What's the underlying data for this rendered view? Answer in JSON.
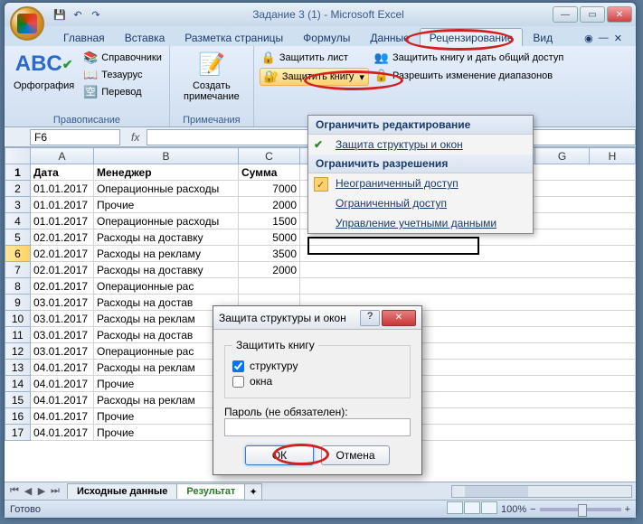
{
  "title": "Задание 3 (1) - Microsoft Excel",
  "qat": {
    "save": "💾",
    "undo": "↶",
    "redo": "↷"
  },
  "tabs": {
    "home": "Главная",
    "insert": "Вставка",
    "page_layout": "Разметка страницы",
    "formulas": "Формулы",
    "data": "Данные",
    "review": "Рецензирование",
    "view": "Вид"
  },
  "ribbon": {
    "spelling_group": "Правописание",
    "spelling": "Орфография",
    "references": "Справочники",
    "thesaurus": "Тезаурус",
    "translate": "Перевод",
    "comments_group": "Примечания",
    "new_comment": "Создать примечание",
    "protect_sheet": "Защитить лист",
    "protect_book": "Защитить книгу",
    "share_book": "Защитить книгу и дать общий доступ",
    "allow_ranges": "Разрешить изменение диапазонов"
  },
  "dropdown": {
    "hdr1": "Ограничить редактирование",
    "item1": "Защита структуры и окон",
    "hdr2": "Ограничить разрешения",
    "item2": "Неограниченный доступ",
    "item3": "Ограниченный доступ",
    "item4": "Управление учетными данными"
  },
  "namebox": "F6",
  "fx": "fx",
  "headers": {
    "rc": "",
    "A": "A",
    "B": "B",
    "C": "C",
    "G": "G",
    "H": "H"
  },
  "colnames": {
    "A": "Дата",
    "B": "Менеджер",
    "C": "Сумма"
  },
  "rows": [
    {
      "n": 2,
      "a": "01.01.2017",
      "b": "Операционные расходы",
      "c": "7000"
    },
    {
      "n": 3,
      "a": "01.01.2017",
      "b": "Прочие",
      "c": "2000"
    },
    {
      "n": 4,
      "a": "01.01.2017",
      "b": "Операционные расходы",
      "c": "1500"
    },
    {
      "n": 5,
      "a": "02.01.2017",
      "b": "Расходы на доставку",
      "c": "5000"
    },
    {
      "n": 6,
      "a": "02.01.2017",
      "b": "Расходы на рекламу",
      "c": "3500"
    },
    {
      "n": 7,
      "a": "02.01.2017",
      "b": "Расходы на доставку",
      "c": "2000"
    },
    {
      "n": 8,
      "a": "02.01.2017",
      "b": "Операционные рас",
      "c": ""
    },
    {
      "n": 9,
      "a": "03.01.2017",
      "b": "Расходы на достав",
      "c": ""
    },
    {
      "n": 10,
      "a": "03.01.2017",
      "b": "Расходы на реклам",
      "c": ""
    },
    {
      "n": 11,
      "a": "03.01.2017",
      "b": "Расходы на достав",
      "c": ""
    },
    {
      "n": 12,
      "a": "03.01.2017",
      "b": "Операционные рас",
      "c": ""
    },
    {
      "n": 13,
      "a": "04.01.2017",
      "b": "Расходы на реклам",
      "c": ""
    },
    {
      "n": 14,
      "a": "04.01.2017",
      "b": "Прочие",
      "c": ""
    },
    {
      "n": 15,
      "a": "04.01.2017",
      "b": "Расходы на реклам",
      "c": ""
    },
    {
      "n": 16,
      "a": "04.01.2017",
      "b": "Прочие",
      "c": ""
    },
    {
      "n": 17,
      "a": "04.01.2017",
      "b": "Прочие",
      "c": ""
    }
  ],
  "sheets": {
    "s1": "Исходные данные",
    "s2": "Результат"
  },
  "status": {
    "ready": "Готово",
    "zoom": "100%"
  },
  "dialog": {
    "title": "Защита структуры и окон",
    "group": "Защитить книгу",
    "structure": "структуру",
    "windows": "окна",
    "password": "Пароль (не обязателен):",
    "ok": "ОК",
    "cancel": "Отмена"
  }
}
